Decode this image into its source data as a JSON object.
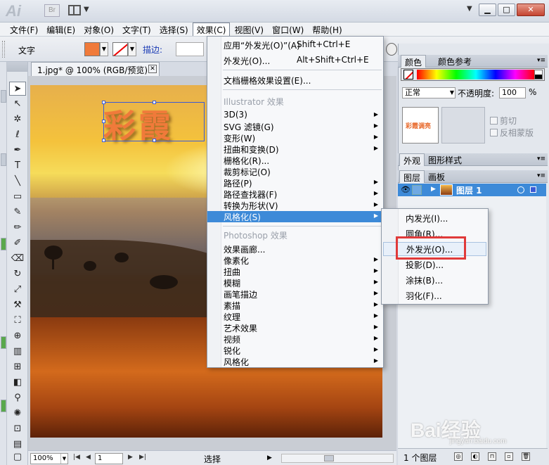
{
  "titlebar": {
    "app_logo": "Ai",
    "bridge_logo": "Br",
    "minimize": "▁",
    "maximize": "□",
    "close": "✕",
    "chevron": "▼"
  },
  "menubar": [
    "文件(F)",
    "编辑(E)",
    "对象(O)",
    "文字(T)",
    "选择(S)",
    "效果(C)",
    "视图(V)",
    "窗口(W)",
    "帮助(H)"
  ],
  "active_menu_index": 5,
  "controlbar": {
    "label": "文字",
    "fill_color": "#f07a3a",
    "stroke_label": "描边:"
  },
  "document": {
    "tab_title": "1.jpg* @ 100% (RGB/预览)",
    "art_text": "彩霞"
  },
  "statusbar": {
    "zoom": "100%",
    "page": "1",
    "mode": "选择"
  },
  "effect_menu": {
    "items": [
      {
        "label": "应用“外发光(O)”(A)",
        "shortcut": "Shift+Ctrl+E"
      },
      {
        "label": "外发光(O)...",
        "shortcut": "Alt+Shift+Ctrl+E"
      },
      {
        "label": "文档栅格效果设置(E)..."
      }
    ],
    "illustrator_header": "Illustrator 效果",
    "illustrator_items": [
      {
        "label": "3D(3)",
        "sub": true
      },
      {
        "label": "SVG 滤镜(G)",
        "sub": true
      },
      {
        "label": "变形(W)",
        "sub": true
      },
      {
        "label": "扭曲和变换(D)",
        "sub": true
      },
      {
        "label": "栅格化(R)...",
        "sub": false
      },
      {
        "label": "裁剪标记(O)",
        "sub": false
      },
      {
        "label": "路径(P)",
        "sub": true
      },
      {
        "label": "路径查找器(F)",
        "sub": true
      },
      {
        "label": "转换为形状(V)",
        "sub": true
      },
      {
        "label": "风格化(S)",
        "sub": true,
        "highlighted": true
      }
    ],
    "photoshop_header": "Photoshop 效果",
    "photoshop_items": [
      {
        "label": "效果画廊...",
        "sub": false
      },
      {
        "label": "像素化",
        "sub": true
      },
      {
        "label": "扭曲",
        "sub": true
      },
      {
        "label": "模糊",
        "sub": true
      },
      {
        "label": "画笔描边",
        "sub": true
      },
      {
        "label": "素描",
        "sub": true
      },
      {
        "label": "纹理",
        "sub": true
      },
      {
        "label": "艺术效果",
        "sub": true
      },
      {
        "label": "视频",
        "sub": true
      },
      {
        "label": "锐化",
        "sub": true
      },
      {
        "label": "风格化",
        "sub": true
      }
    ]
  },
  "stylize_submenu": [
    "内发光(I)...",
    "圆角(R)...",
    "外发光(O)...",
    "投影(D)...",
    "涂抹(B)...",
    "羽化(F)..."
  ],
  "stylize_hover_index": 2,
  "panels": {
    "color_tabs": [
      "颜色",
      "颜色参考"
    ],
    "blend_mode": "正常",
    "opacity_label": "不透明度:",
    "opacity_value": "100",
    "opacity_unit": "%",
    "thumb_text": "彩霞调亮",
    "clip_label": "剪切",
    "invert_mask_label": "反相蒙版",
    "appearance_tabs": [
      "外观",
      "图形样式"
    ],
    "layers_tabs": [
      "图层",
      "画板"
    ],
    "layer_name": "图层 1",
    "layer_count": "1 个图层"
  },
  "watermark": {
    "brand": "Bai经验",
    "url": "jingyan.baidu.com"
  },
  "colors": {
    "menu_highlight": "#3d8ad8",
    "annotation": "#e03a3a",
    "art_text": "#f07a3a"
  }
}
